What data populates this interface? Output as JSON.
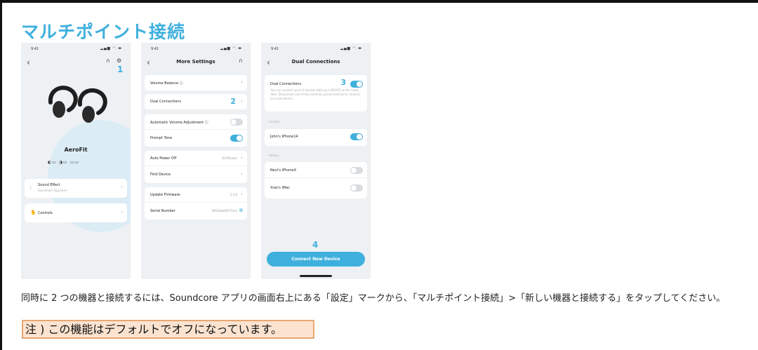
{
  "title": "マルチポイント接続",
  "status": {
    "time": "9:41",
    "sys": "▂▄▆ ◠ ▬"
  },
  "phone1": {
    "step": "1",
    "device_name": "AeroFit",
    "battery": "◐▭  ◑▭  ▭▭",
    "sound_effect": {
      "label": "Sound Effect",
      "sub": "Soundcore Signature"
    },
    "controls": {
      "label": "Controls"
    }
  },
  "phone2": {
    "nav_title": "More Settings",
    "step": "2",
    "rows": {
      "volume_balance": "Volume Balance  ⓘ",
      "dual_connections": "Dual Connections",
      "auto_volume": "Automatic Volume Adjustment  ⓘ",
      "prompt_tone": "Prompt Tone",
      "auto_power_off": "Auto Power Off",
      "auto_power_off_value": "30 Minutes",
      "find_device": "Find Device",
      "update_firmware": "Update Firmware",
      "update_firmware_value": "2.3.0",
      "serial_number": "Serial Number",
      "serial_number_value": "3952abb4f0712ac"
    }
  },
  "phone3": {
    "nav_title": "Dual Connections",
    "step3": "3",
    "step4": "4",
    "dual_label": "Dual Connections",
    "dual_desc": "You can connect up to 2 devices with your DEVICE at the same time. Disconnect one of the currently paired devices to connect to a new device.",
    "current_label": "Current",
    "current_device": "John's iPhone14",
    "history_label": "History",
    "history": [
      "Nevi's iPhoneX",
      "Xiao's iMac"
    ],
    "connect_button": "Connect New Device"
  },
  "description": "同時に 2 つの機器と接続するには、Soundcore アプリの画面右上にある「設定」マークから、「マルチポイント接続」>「新しい機器と接続する」をタップしてください。",
  "note": "注 ) この機能はデフォルトでオフになっています。"
}
